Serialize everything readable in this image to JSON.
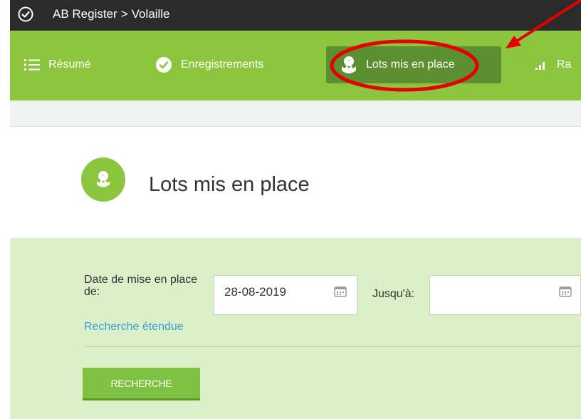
{
  "topbar": {
    "breadcrumb": [
      "AB Register",
      "Volaille"
    ],
    "separator": ">"
  },
  "nav": {
    "items": [
      {
        "label": "Résumé",
        "icon": "list-icon"
      },
      {
        "label": "Enregistrements",
        "icon": "check-circle-icon"
      },
      {
        "label": "Lots mis en place",
        "icon": "chick-icon",
        "active": true
      },
      {
        "label": "Ra",
        "icon": "signal-bars-icon"
      }
    ]
  },
  "page": {
    "title": "Lots mis en place"
  },
  "form": {
    "date_from_label": "Date de mise en place de:",
    "date_from_value": "28-08-2019",
    "date_to_label": "Jusqu'à:",
    "date_to_value": "",
    "advanced_search_link": "Recherche étendue",
    "search_button": "RECHERCHE"
  },
  "colors": {
    "nav_green": "#8cc63f",
    "active_tab": "#5c8f2f",
    "form_bg": "#dbf0c8",
    "annotation_red": "#e60000",
    "link": "#3aa0d8"
  }
}
